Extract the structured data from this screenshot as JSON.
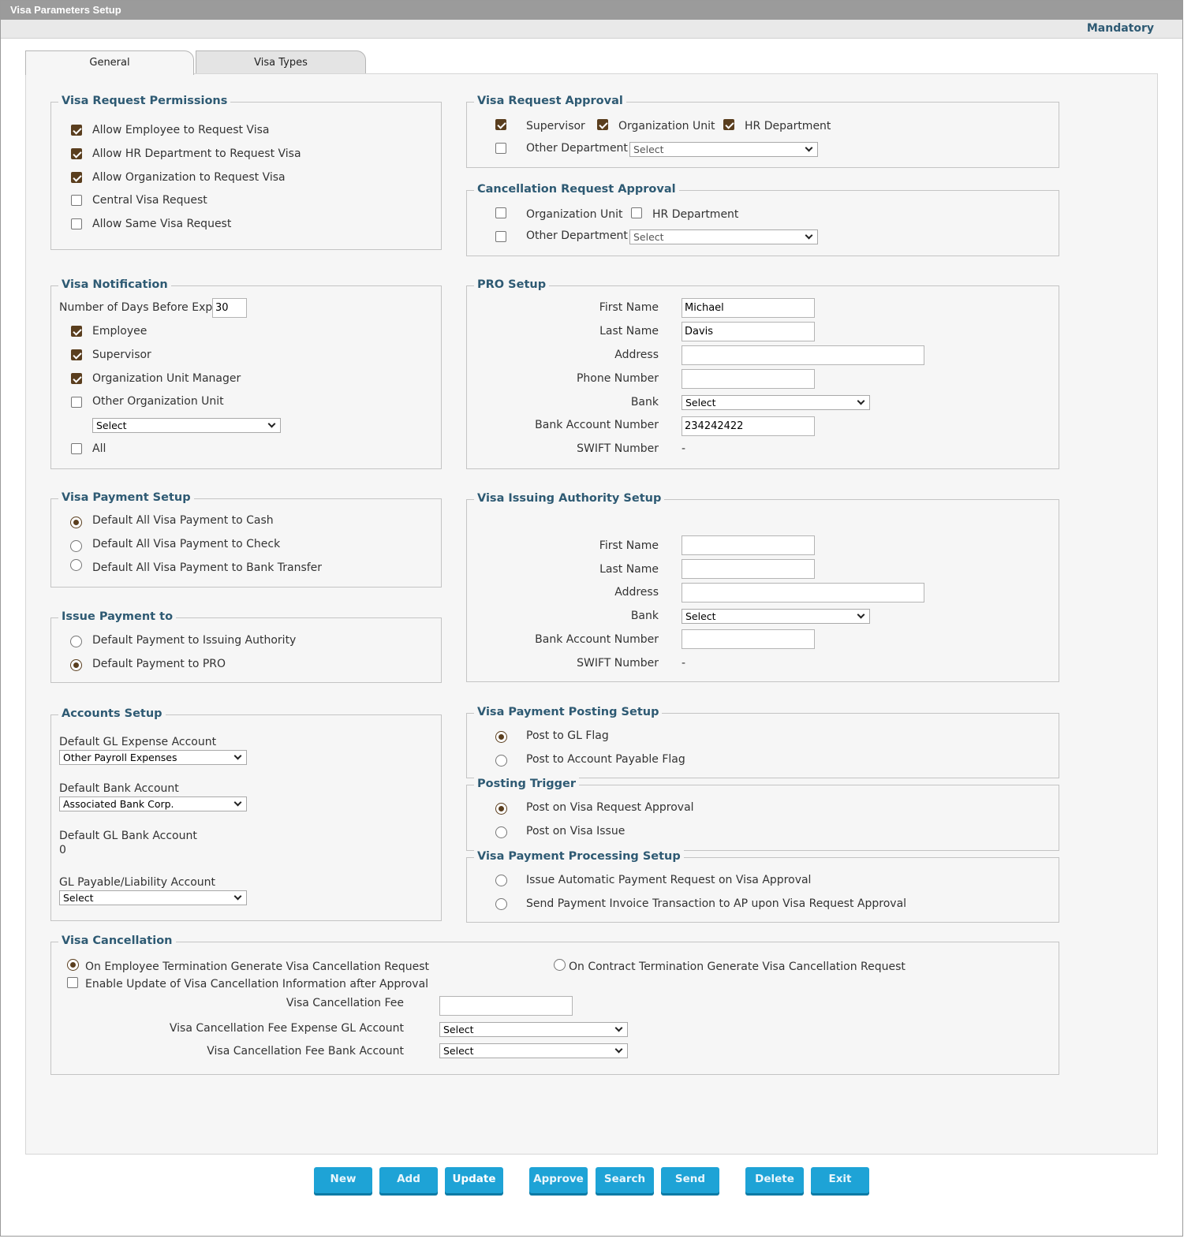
{
  "window": {
    "title": "Visa Parameters Setup",
    "mandatory_label": "Mandatory"
  },
  "tabs": {
    "general": "General",
    "visa_types": "Visa Types"
  },
  "request_permissions": {
    "legend": "Visa Request Permissions",
    "items": [
      {
        "label": "Allow Employee to Request Visa",
        "checked": true
      },
      {
        "label": "Allow HR Department to Request Visa",
        "checked": true
      },
      {
        "label": "Allow Organization to Request Visa",
        "checked": true
      },
      {
        "label": "Central Visa Request",
        "checked": false
      },
      {
        "label": "Allow Same Visa Request",
        "checked": false
      }
    ]
  },
  "request_approval": {
    "legend": "Visa Request Approval",
    "supervisor": "Supervisor",
    "supervisor_checked": true,
    "org_unit": "Organization Unit",
    "org_unit_checked": true,
    "hr_dept": "HR Department",
    "hr_dept_checked": true,
    "other_dept": "Other Department",
    "other_dept_checked": false,
    "other_dept_select": "Select"
  },
  "cancellation_approval": {
    "legend": "Cancellation Request Approval",
    "org_unit": "Organization Unit",
    "org_unit_checked": false,
    "hr_dept": "HR Department",
    "hr_dept_checked": false,
    "other_dept": "Other Department",
    "other_dept_checked": false,
    "other_dept_select": "Select"
  },
  "notification": {
    "legend": "Visa Notification",
    "days_label": "Number of Days Before Expiry",
    "days_value": "30",
    "employee": "Employee",
    "employee_checked": true,
    "supervisor": "Supervisor",
    "supervisor_checked": true,
    "org_manager": "Organization Unit Manager",
    "org_manager_checked": true,
    "other_org": "Other Organization Unit",
    "other_org_checked": false,
    "other_org_select": "Select",
    "all": "All",
    "all_checked": false
  },
  "pro_setup": {
    "legend": "PRO Setup",
    "first_name_label": "First Name",
    "first_name": "Michael",
    "last_name_label": "Last Name",
    "last_name": "Davis",
    "address_label": "Address",
    "address": "",
    "phone_label": "Phone Number",
    "phone": "",
    "bank_label": "Bank",
    "bank": "Select",
    "account_label": "Bank Account Number",
    "account": "234242422",
    "swift_label": "SWIFT Number",
    "swift": "-"
  },
  "payment_setup": {
    "legend": "Visa Payment Setup",
    "options": [
      {
        "label": "Default All Visa Payment to Cash",
        "selected": true
      },
      {
        "label": "Default All Visa Payment to Check",
        "selected": false
      },
      {
        "label": "Default All Visa Payment to Bank Transfer",
        "selected": false
      }
    ]
  },
  "issuing_authority": {
    "legend": "Visa Issuing Authority Setup",
    "first_name_label": "First Name",
    "first_name": "",
    "last_name_label": "Last Name",
    "last_name": "",
    "address_label": "Address",
    "address": "",
    "bank_label": "Bank",
    "bank": "Select",
    "account_label": "Bank Account Number",
    "account": "",
    "swift_label": "SWIFT Number",
    "swift": "-"
  },
  "issue_payment": {
    "legend": "Issue Payment to",
    "options": [
      {
        "label": "Default Payment to Issuing Authority",
        "selected": false
      },
      {
        "label": "Default Payment to PRO",
        "selected": true
      }
    ]
  },
  "accounts": {
    "legend": "Accounts Setup",
    "gl_expense_label": "Default GL Expense Account",
    "gl_expense": "Other Payroll Expenses",
    "bank_label": "Default Bank Account",
    "bank": "Associated Bank Corp.",
    "gl_bank_label": "Default GL Bank Account",
    "gl_bank": "0",
    "gl_payable_label": "GL Payable/Liability Account",
    "gl_payable": "Select"
  },
  "posting_setup": {
    "legend": "Visa Payment Posting Setup",
    "options": [
      {
        "label": "Post to GL Flag",
        "selected": true
      },
      {
        "label": "Post to Account Payable Flag",
        "selected": false
      }
    ]
  },
  "posting_trigger": {
    "legend": "Posting Trigger",
    "options": [
      {
        "label": "Post on Visa Request Approval",
        "selected": true
      },
      {
        "label": "Post on Visa Issue",
        "selected": false
      }
    ]
  },
  "processing_setup": {
    "legend": "Visa Payment Processing Setup",
    "options": [
      {
        "label": "Issue Automatic Payment Request on Visa Approval",
        "selected": false
      },
      {
        "label": "Send Payment Invoice Transaction to AP upon Visa Request Approval",
        "selected": false
      }
    ]
  },
  "cancellation": {
    "legend": "Visa Cancellation",
    "on_employee_term": "On Employee Termination Generate Visa Cancellation Request",
    "on_employee_term_selected": true,
    "on_contract_term": "On Contract Termination Generate Visa Cancellation Request",
    "on_contract_term_selected": false,
    "enable_update": "Enable Update of Visa Cancellation Information after Approval",
    "enable_update_checked": false,
    "fee_label": "Visa Cancellation Fee",
    "fee": "",
    "fee_gl_label": "Visa Cancellation Fee Expense GL Account",
    "fee_gl": "Select",
    "fee_bank_label": "Visa Cancellation Fee Bank Account",
    "fee_bank": "Select"
  },
  "buttons": {
    "new": "New",
    "add": "Add",
    "update": "Update",
    "approve": "Approve",
    "search": "Search",
    "send": "Send",
    "delete": "Delete",
    "exit": "Exit"
  },
  "colors": {
    "accent": "#2e5a73",
    "button": "#1ea3d6",
    "check": "#5a3e1e"
  }
}
